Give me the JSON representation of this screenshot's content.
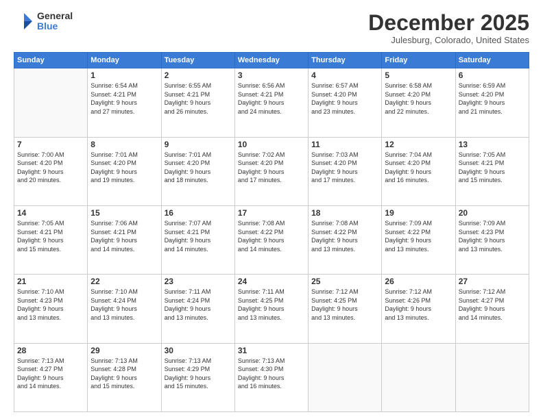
{
  "logo": {
    "general": "General",
    "blue": "Blue"
  },
  "header": {
    "month": "December 2025",
    "location": "Julesburg, Colorado, United States"
  },
  "weekdays": [
    "Sunday",
    "Monday",
    "Tuesday",
    "Wednesday",
    "Thursday",
    "Friday",
    "Saturday"
  ],
  "weeks": [
    [
      {
        "day": "",
        "info": ""
      },
      {
        "day": "1",
        "info": "Sunrise: 6:54 AM\nSunset: 4:21 PM\nDaylight: 9 hours\nand 27 minutes."
      },
      {
        "day": "2",
        "info": "Sunrise: 6:55 AM\nSunset: 4:21 PM\nDaylight: 9 hours\nand 26 minutes."
      },
      {
        "day": "3",
        "info": "Sunrise: 6:56 AM\nSunset: 4:21 PM\nDaylight: 9 hours\nand 24 minutes."
      },
      {
        "day": "4",
        "info": "Sunrise: 6:57 AM\nSunset: 4:20 PM\nDaylight: 9 hours\nand 23 minutes."
      },
      {
        "day": "5",
        "info": "Sunrise: 6:58 AM\nSunset: 4:20 PM\nDaylight: 9 hours\nand 22 minutes."
      },
      {
        "day": "6",
        "info": "Sunrise: 6:59 AM\nSunset: 4:20 PM\nDaylight: 9 hours\nand 21 minutes."
      }
    ],
    [
      {
        "day": "7",
        "info": "Sunrise: 7:00 AM\nSunset: 4:20 PM\nDaylight: 9 hours\nand 20 minutes."
      },
      {
        "day": "8",
        "info": "Sunrise: 7:01 AM\nSunset: 4:20 PM\nDaylight: 9 hours\nand 19 minutes."
      },
      {
        "day": "9",
        "info": "Sunrise: 7:01 AM\nSunset: 4:20 PM\nDaylight: 9 hours\nand 18 minutes."
      },
      {
        "day": "10",
        "info": "Sunrise: 7:02 AM\nSunset: 4:20 PM\nDaylight: 9 hours\nand 17 minutes."
      },
      {
        "day": "11",
        "info": "Sunrise: 7:03 AM\nSunset: 4:20 PM\nDaylight: 9 hours\nand 17 minutes."
      },
      {
        "day": "12",
        "info": "Sunrise: 7:04 AM\nSunset: 4:20 PM\nDaylight: 9 hours\nand 16 minutes."
      },
      {
        "day": "13",
        "info": "Sunrise: 7:05 AM\nSunset: 4:21 PM\nDaylight: 9 hours\nand 15 minutes."
      }
    ],
    [
      {
        "day": "14",
        "info": "Sunrise: 7:05 AM\nSunset: 4:21 PM\nDaylight: 9 hours\nand 15 minutes."
      },
      {
        "day": "15",
        "info": "Sunrise: 7:06 AM\nSunset: 4:21 PM\nDaylight: 9 hours\nand 14 minutes."
      },
      {
        "day": "16",
        "info": "Sunrise: 7:07 AM\nSunset: 4:21 PM\nDaylight: 9 hours\nand 14 minutes."
      },
      {
        "day": "17",
        "info": "Sunrise: 7:08 AM\nSunset: 4:22 PM\nDaylight: 9 hours\nand 14 minutes."
      },
      {
        "day": "18",
        "info": "Sunrise: 7:08 AM\nSunset: 4:22 PM\nDaylight: 9 hours\nand 13 minutes."
      },
      {
        "day": "19",
        "info": "Sunrise: 7:09 AM\nSunset: 4:22 PM\nDaylight: 9 hours\nand 13 minutes."
      },
      {
        "day": "20",
        "info": "Sunrise: 7:09 AM\nSunset: 4:23 PM\nDaylight: 9 hours\nand 13 minutes."
      }
    ],
    [
      {
        "day": "21",
        "info": "Sunrise: 7:10 AM\nSunset: 4:23 PM\nDaylight: 9 hours\nand 13 minutes."
      },
      {
        "day": "22",
        "info": "Sunrise: 7:10 AM\nSunset: 4:24 PM\nDaylight: 9 hours\nand 13 minutes."
      },
      {
        "day": "23",
        "info": "Sunrise: 7:11 AM\nSunset: 4:24 PM\nDaylight: 9 hours\nand 13 minutes."
      },
      {
        "day": "24",
        "info": "Sunrise: 7:11 AM\nSunset: 4:25 PM\nDaylight: 9 hours\nand 13 minutes."
      },
      {
        "day": "25",
        "info": "Sunrise: 7:12 AM\nSunset: 4:25 PM\nDaylight: 9 hours\nand 13 minutes."
      },
      {
        "day": "26",
        "info": "Sunrise: 7:12 AM\nSunset: 4:26 PM\nDaylight: 9 hours\nand 13 minutes."
      },
      {
        "day": "27",
        "info": "Sunrise: 7:12 AM\nSunset: 4:27 PM\nDaylight: 9 hours\nand 14 minutes."
      }
    ],
    [
      {
        "day": "28",
        "info": "Sunrise: 7:13 AM\nSunset: 4:27 PM\nDaylight: 9 hours\nand 14 minutes."
      },
      {
        "day": "29",
        "info": "Sunrise: 7:13 AM\nSunset: 4:28 PM\nDaylight: 9 hours\nand 15 minutes."
      },
      {
        "day": "30",
        "info": "Sunrise: 7:13 AM\nSunset: 4:29 PM\nDaylight: 9 hours\nand 15 minutes."
      },
      {
        "day": "31",
        "info": "Sunrise: 7:13 AM\nSunset: 4:30 PM\nDaylight: 9 hours\nand 16 minutes."
      },
      {
        "day": "",
        "info": ""
      },
      {
        "day": "",
        "info": ""
      },
      {
        "day": "",
        "info": ""
      }
    ]
  ]
}
